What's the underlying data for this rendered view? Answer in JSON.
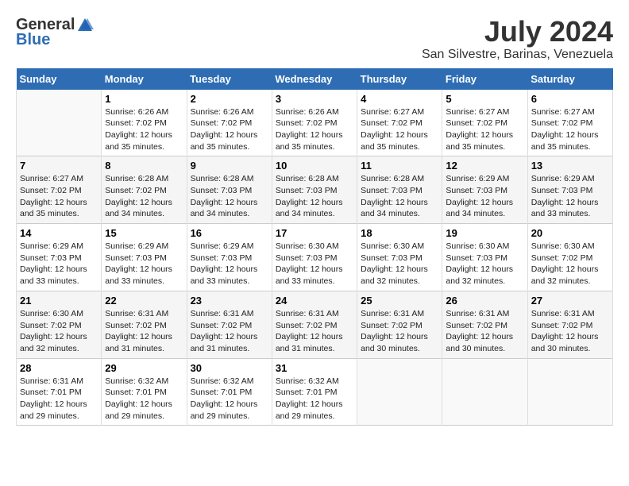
{
  "header": {
    "logo_general": "General",
    "logo_blue": "Blue",
    "month_year": "July 2024",
    "location": "San Silvestre, Barinas, Venezuela"
  },
  "weekdays": [
    "Sunday",
    "Monday",
    "Tuesday",
    "Wednesday",
    "Thursday",
    "Friday",
    "Saturday"
  ],
  "weeks": [
    [
      {
        "day": "",
        "info": ""
      },
      {
        "day": "1",
        "info": "Sunrise: 6:26 AM\nSunset: 7:02 PM\nDaylight: 12 hours\nand 35 minutes."
      },
      {
        "day": "2",
        "info": "Sunrise: 6:26 AM\nSunset: 7:02 PM\nDaylight: 12 hours\nand 35 minutes."
      },
      {
        "day": "3",
        "info": "Sunrise: 6:26 AM\nSunset: 7:02 PM\nDaylight: 12 hours\nand 35 minutes."
      },
      {
        "day": "4",
        "info": "Sunrise: 6:27 AM\nSunset: 7:02 PM\nDaylight: 12 hours\nand 35 minutes."
      },
      {
        "day": "5",
        "info": "Sunrise: 6:27 AM\nSunset: 7:02 PM\nDaylight: 12 hours\nand 35 minutes."
      },
      {
        "day": "6",
        "info": "Sunrise: 6:27 AM\nSunset: 7:02 PM\nDaylight: 12 hours\nand 35 minutes."
      }
    ],
    [
      {
        "day": "7",
        "info": "Sunrise: 6:27 AM\nSunset: 7:02 PM\nDaylight: 12 hours\nand 35 minutes."
      },
      {
        "day": "8",
        "info": "Sunrise: 6:28 AM\nSunset: 7:02 PM\nDaylight: 12 hours\nand 34 minutes."
      },
      {
        "day": "9",
        "info": "Sunrise: 6:28 AM\nSunset: 7:03 PM\nDaylight: 12 hours\nand 34 minutes."
      },
      {
        "day": "10",
        "info": "Sunrise: 6:28 AM\nSunset: 7:03 PM\nDaylight: 12 hours\nand 34 minutes."
      },
      {
        "day": "11",
        "info": "Sunrise: 6:28 AM\nSunset: 7:03 PM\nDaylight: 12 hours\nand 34 minutes."
      },
      {
        "day": "12",
        "info": "Sunrise: 6:29 AM\nSunset: 7:03 PM\nDaylight: 12 hours\nand 34 minutes."
      },
      {
        "day": "13",
        "info": "Sunrise: 6:29 AM\nSunset: 7:03 PM\nDaylight: 12 hours\nand 33 minutes."
      }
    ],
    [
      {
        "day": "14",
        "info": "Sunrise: 6:29 AM\nSunset: 7:03 PM\nDaylight: 12 hours\nand 33 minutes."
      },
      {
        "day": "15",
        "info": "Sunrise: 6:29 AM\nSunset: 7:03 PM\nDaylight: 12 hours\nand 33 minutes."
      },
      {
        "day": "16",
        "info": "Sunrise: 6:29 AM\nSunset: 7:03 PM\nDaylight: 12 hours\nand 33 minutes."
      },
      {
        "day": "17",
        "info": "Sunrise: 6:30 AM\nSunset: 7:03 PM\nDaylight: 12 hours\nand 33 minutes."
      },
      {
        "day": "18",
        "info": "Sunrise: 6:30 AM\nSunset: 7:03 PM\nDaylight: 12 hours\nand 32 minutes."
      },
      {
        "day": "19",
        "info": "Sunrise: 6:30 AM\nSunset: 7:03 PM\nDaylight: 12 hours\nand 32 minutes."
      },
      {
        "day": "20",
        "info": "Sunrise: 6:30 AM\nSunset: 7:02 PM\nDaylight: 12 hours\nand 32 minutes."
      }
    ],
    [
      {
        "day": "21",
        "info": "Sunrise: 6:30 AM\nSunset: 7:02 PM\nDaylight: 12 hours\nand 32 minutes."
      },
      {
        "day": "22",
        "info": "Sunrise: 6:31 AM\nSunset: 7:02 PM\nDaylight: 12 hours\nand 31 minutes."
      },
      {
        "day": "23",
        "info": "Sunrise: 6:31 AM\nSunset: 7:02 PM\nDaylight: 12 hours\nand 31 minutes."
      },
      {
        "day": "24",
        "info": "Sunrise: 6:31 AM\nSunset: 7:02 PM\nDaylight: 12 hours\nand 31 minutes."
      },
      {
        "day": "25",
        "info": "Sunrise: 6:31 AM\nSunset: 7:02 PM\nDaylight: 12 hours\nand 30 minutes."
      },
      {
        "day": "26",
        "info": "Sunrise: 6:31 AM\nSunset: 7:02 PM\nDaylight: 12 hours\nand 30 minutes."
      },
      {
        "day": "27",
        "info": "Sunrise: 6:31 AM\nSunset: 7:02 PM\nDaylight: 12 hours\nand 30 minutes."
      }
    ],
    [
      {
        "day": "28",
        "info": "Sunrise: 6:31 AM\nSunset: 7:01 PM\nDaylight: 12 hours\nand 29 minutes."
      },
      {
        "day": "29",
        "info": "Sunrise: 6:32 AM\nSunset: 7:01 PM\nDaylight: 12 hours\nand 29 minutes."
      },
      {
        "day": "30",
        "info": "Sunrise: 6:32 AM\nSunset: 7:01 PM\nDaylight: 12 hours\nand 29 minutes."
      },
      {
        "day": "31",
        "info": "Sunrise: 6:32 AM\nSunset: 7:01 PM\nDaylight: 12 hours\nand 29 minutes."
      },
      {
        "day": "",
        "info": ""
      },
      {
        "day": "",
        "info": ""
      },
      {
        "day": "",
        "info": ""
      }
    ]
  ]
}
